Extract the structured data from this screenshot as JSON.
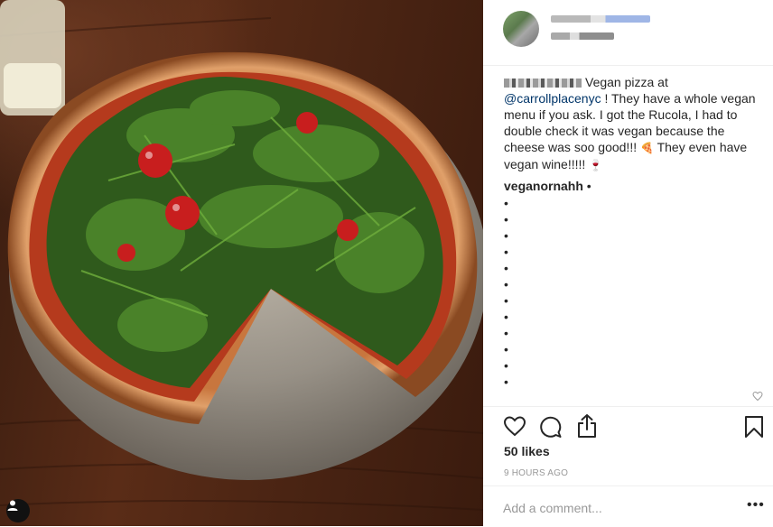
{
  "post": {
    "caption_text": "Vegan pizza at",
    "mention": "@carrollplacenyc",
    "caption_rest": " ! They have a whole vegan menu if you ask. I got the Rucola, I had to double check it was vegan because the cheese was soo good!!!",
    "caption_emoji_1": "🍕",
    "caption_end": " They even have vegan wine!!!!!",
    "caption_emoji_2": "🍷"
  },
  "comment": {
    "username": "veganornahh",
    "separator": " •",
    "bullet": "•"
  },
  "likes_label": "50 likes",
  "time_label": "9 HOURS AGO",
  "add_comment": {
    "placeholder": "Add a comment..."
  },
  "more_label": "•••",
  "icons": {
    "like": "heart-icon",
    "comment": "comment-bubble-icon",
    "share": "share-icon",
    "save": "bookmark-icon",
    "user_tag": "user-icon",
    "comment_like": "small-heart-icon"
  },
  "colors": {
    "mention": "#003569",
    "text": "#262626",
    "muted": "#999999",
    "border": "#efefef"
  }
}
